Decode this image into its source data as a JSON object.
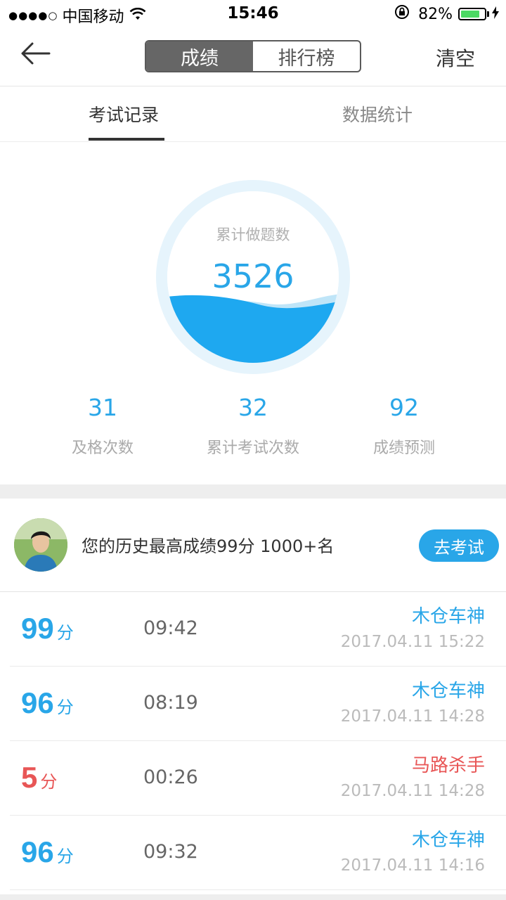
{
  "status_bar": {
    "signal": "●●●●○",
    "carrier": "中国移动",
    "time": "15:46",
    "battery_percent": "82%",
    "battery_level": 0.82,
    "icons": [
      "wifi-icon",
      "rotation-lock-icon",
      "battery-icon",
      "charging-icon"
    ]
  },
  "nav": {
    "back_icon": "arrow-left-icon",
    "segments": [
      "成绩",
      "排行榜"
    ],
    "active_segment": 0,
    "clear_label": "清空"
  },
  "tabs": {
    "items": [
      "考试记录",
      "数据统计"
    ],
    "active": 0
  },
  "gauge": {
    "label": "累计做题数",
    "value": "3526"
  },
  "stats": [
    {
      "value": "31",
      "label": "及格次数"
    },
    {
      "value": "32",
      "label": "累计考试次数"
    },
    {
      "value": "92",
      "label": "成绩预测"
    }
  ],
  "best": {
    "text": "您的历史最高成绩99分  1000+名",
    "button_label": "去考试"
  },
  "records": [
    {
      "score": "99",
      "unit": "分",
      "duration": "09:42",
      "title": "木仓车神",
      "date": "2017.04.11 15:22",
      "color": "#29a6e8"
    },
    {
      "score": "96",
      "unit": "分",
      "duration": "08:19",
      "title": "木仓车神",
      "date": "2017.04.11 14:28",
      "color": "#29a6e8"
    },
    {
      "score": "5",
      "unit": "分",
      "duration": "00:26",
      "title": "马路杀手",
      "date": "2017.04.11 14:28",
      "color": "#e85656"
    },
    {
      "score": "96",
      "unit": "分",
      "duration": "09:32",
      "title": "木仓车神",
      "date": "2017.04.11 14:16",
      "color": "#29a6e8"
    }
  ],
  "colors": {
    "accent": "#29a6e8",
    "fail": "#e85656",
    "segment_active": "#666666"
  }
}
